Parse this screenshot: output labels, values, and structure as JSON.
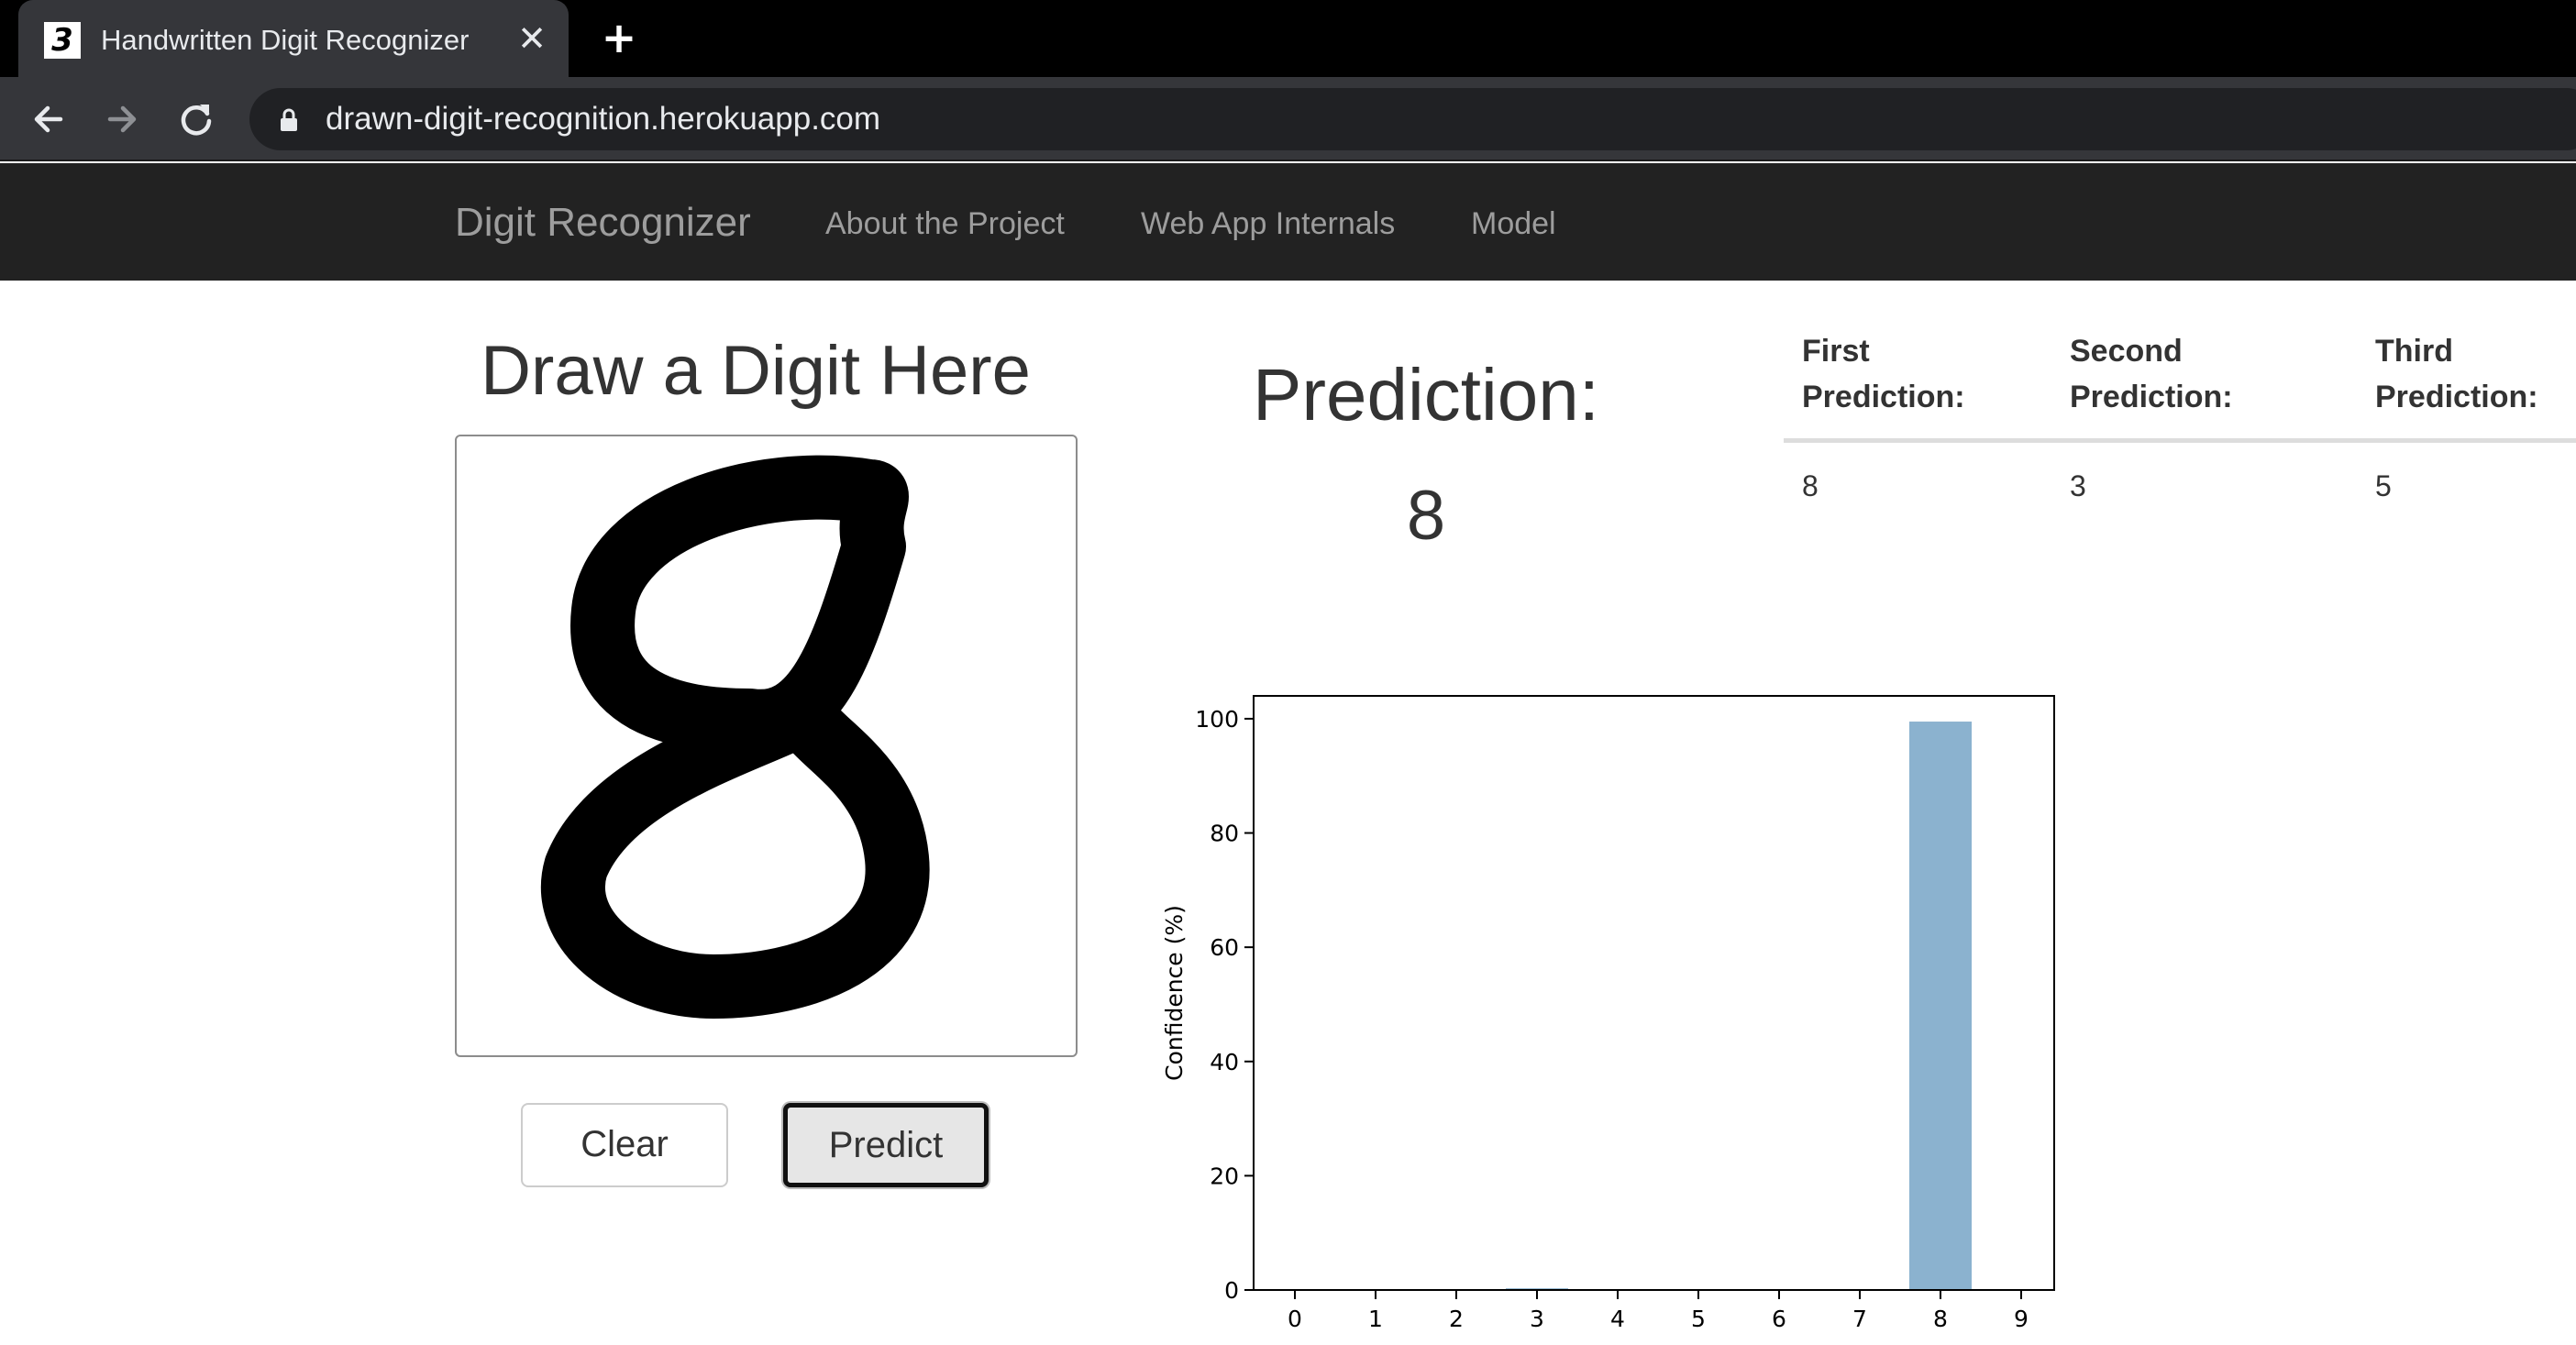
{
  "browser": {
    "tab_title": "Handwritten Digit Recognizer",
    "favicon_glyph": "3",
    "close_glyph": "✕",
    "new_tab_glyph": "+",
    "url": "drawn-digit-recognition.herokuapp.com",
    "icons": [
      "back-arrow-icon",
      "forward-arrow-icon",
      "reload-icon",
      "lock-icon"
    ]
  },
  "navbar": {
    "brand": "Digit Recognizer",
    "links": [
      "About the Project",
      "Web App Internals",
      "Model"
    ]
  },
  "draw": {
    "heading": "Draw a Digit Here",
    "clear_label": "Clear",
    "predict_label": "Predict"
  },
  "prediction": {
    "heading": "Prediction:",
    "value": "8"
  },
  "top_predictions": {
    "headers": [
      [
        "First",
        "Prediction:"
      ],
      [
        "Second",
        "Prediction:"
      ],
      [
        "Third",
        "Prediction:"
      ]
    ],
    "values": [
      "8",
      "3",
      "5"
    ]
  },
  "colors": {
    "bar": "#8bb2cf",
    "navbar": "#222222",
    "chrome": "#35363a"
  },
  "chart_data": {
    "type": "bar",
    "categories": [
      "0",
      "1",
      "2",
      "3",
      "4",
      "5",
      "6",
      "7",
      "8",
      "9"
    ],
    "values": [
      0,
      0,
      0,
      0.3,
      0,
      0,
      0,
      0,
      99.5,
      0
    ],
    "title": "",
    "xlabel": "",
    "ylabel": "Confidence (%)",
    "ylim": [
      0,
      104
    ],
    "yticks": [
      0,
      20,
      40,
      60,
      80,
      100
    ],
    "grid": false,
    "legend": "none"
  }
}
